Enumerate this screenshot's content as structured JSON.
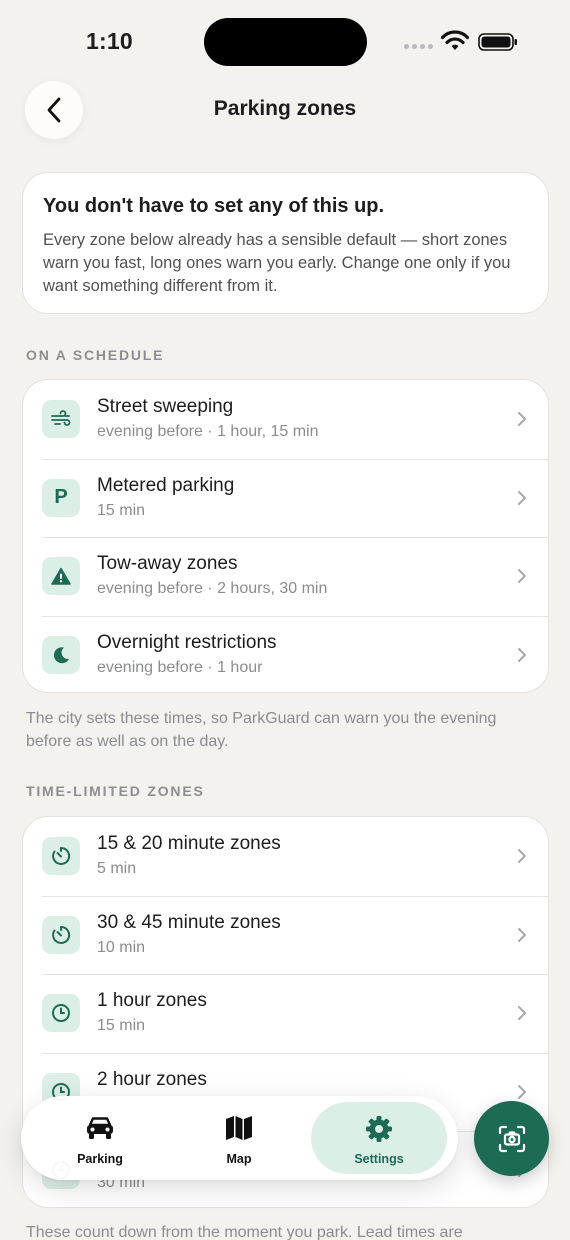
{
  "status_bar": {
    "time": "1:10"
  },
  "header": {
    "title": "Parking zones"
  },
  "info_card": {
    "title": "You don't have to set any of this up.",
    "body": "Every zone below already has a sensible default — short zones warn you fast, long ones warn you early. Change one only if you want something different from it."
  },
  "schedule": {
    "label": "ON A SCHEDULE",
    "items": [
      {
        "title": "Street sweeping",
        "subtitle": "evening before · 1 hour, 15 min",
        "icon": "wind-icon"
      },
      {
        "title": "Metered parking",
        "subtitle": "15 min",
        "icon": "parking-p-icon",
        "glyph": "P"
      },
      {
        "title": "Tow-away zones",
        "subtitle": "evening before · 2 hours, 30 min",
        "icon": "warning-icon"
      },
      {
        "title": "Overnight restrictions",
        "subtitle": "evening before · 1 hour",
        "icon": "moon-icon"
      }
    ],
    "footnote": "The city sets these times, so ParkGuard can warn you the evening before as well as on the day."
  },
  "time_limited": {
    "label": "TIME-LIMITED ZONES",
    "items": [
      {
        "title": "15 & 20 minute zones",
        "subtitle": "5 min",
        "icon": "timer-icon"
      },
      {
        "title": "30 & 45 minute zones",
        "subtitle": "10 min",
        "icon": "timer-icon"
      },
      {
        "title": "1 hour zones",
        "subtitle": "15 min",
        "icon": "clock-icon"
      },
      {
        "title": "2 hour zones",
        "subtitle": "",
        "icon": "clock-icon"
      },
      {
        "title": "",
        "subtitle": "30 min",
        "icon": "clock-icon"
      }
    ],
    "footnote": "These count down from the moment you park. Lead times are"
  },
  "tab_bar": {
    "tabs": [
      {
        "label": "Parking",
        "icon": "car-icon"
      },
      {
        "label": "Map",
        "icon": "map-icon"
      },
      {
        "label": "Settings",
        "icon": "gear-icon",
        "active": true
      }
    ]
  },
  "colors": {
    "accent": "#1e6b55",
    "accent_light": "#dcefe7",
    "background": "#f3f2ee"
  }
}
